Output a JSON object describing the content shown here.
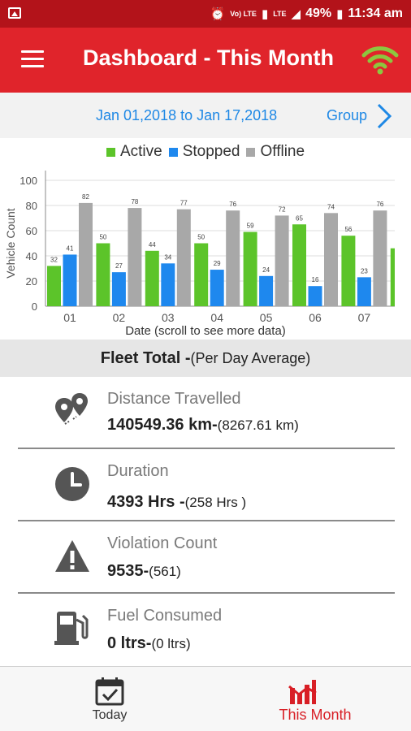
{
  "status_bar": {
    "volte": "Vo) LTE",
    "lte": "LTE",
    "battery": "49%",
    "time": "11:34 am"
  },
  "app_bar": {
    "title": "Dashboard - This Month"
  },
  "date_bar": {
    "range": "Jan 01,2018 to Jan 17,2018",
    "group_label": "Group"
  },
  "colors": {
    "primary_red": "#e0242b",
    "status_red": "#b3131a",
    "active": "#5cc42a",
    "stopped": "#1e88ee",
    "offline": "#a8a8a8",
    "link_blue": "#1e88e5"
  },
  "chart_data": {
    "type": "bar",
    "legend_position": "top-center",
    "grid": true,
    "xlabel": "Date (scroll to see more data)",
    "ylabel": "Vehicle Count",
    "ylim": [
      0,
      100
    ],
    "yticks": [
      0,
      20,
      40,
      60,
      80,
      100
    ],
    "categories": [
      "01",
      "02",
      "03",
      "04",
      "05",
      "06",
      "07"
    ],
    "series": [
      {
        "name": "Active",
        "color": "#5cc42a",
        "values": [
          32,
          50,
          44,
          50,
          59,
          65,
          56
        ]
      },
      {
        "name": "Stopped",
        "color": "#1e88ee",
        "values": [
          41,
          27,
          34,
          29,
          24,
          16,
          23
        ]
      },
      {
        "name": "Offline",
        "color": "#a8a8a8",
        "values": [
          82,
          78,
          77,
          76,
          72,
          74,
          76
        ]
      }
    ],
    "partial_next_active": 46
  },
  "fleet": {
    "title": "Fleet Total -",
    "subtitle": "(Per Day Average)"
  },
  "metrics": [
    {
      "label": "Distance Travelled",
      "value": "140549.36 km-",
      "average": "(8267.61 km)",
      "icon": "location-pins-icon"
    },
    {
      "label": "Duration",
      "value": "4393 Hrs -",
      "average": "(258 Hrs )",
      "icon": "clock-icon"
    },
    {
      "label": "Violation Count",
      "value": "9535-",
      "average": "(561)",
      "icon": "warning-icon"
    },
    {
      "label": "Fuel Consumed",
      "value": "0 ltrs-",
      "average": "(0 ltrs)",
      "icon": "fuel-pump-icon"
    }
  ],
  "bottom_nav": {
    "today": "Today",
    "this_month": "This Month"
  }
}
